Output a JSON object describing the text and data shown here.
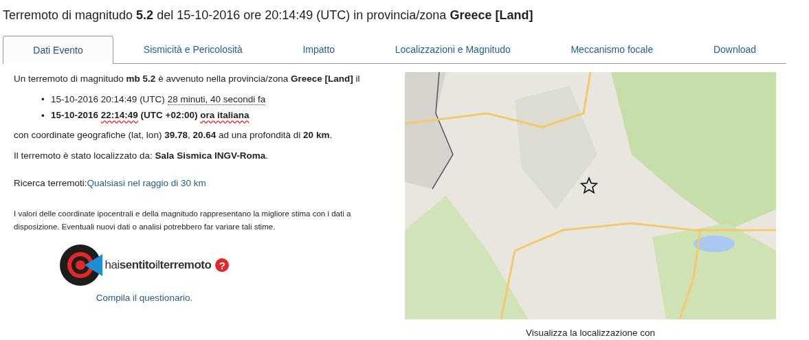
{
  "page_title": "Terremoto di magnitudo **5.2** del 15-10-2016 ore 20:14:49 (UTC) in provincia/zona **Greece [Land]**",
  "tabs": [
    {
      "label": "Dati Evento",
      "selected": true
    },
    {
      "label": "Sismicità e Pericolosità",
      "selected": false
    },
    {
      "label": "Impatto",
      "selected": false
    },
    {
      "label": "Localizzazioni e Magnitudo",
      "selected": false
    },
    {
      "label": "Meccanismo focale",
      "selected": false
    },
    {
      "label": "Download",
      "selected": false
    }
  ],
  "intro": "Un terremoto di magnitudo **mb 5.2** è avvenuto nella provincia/zona **Greece [Land]** il",
  "times": [
    {
      "kind": "utc",
      "bullet": "•",
      "date": "15-10-2016",
      "time": "20:14:49",
      "zone": "(UTC)",
      "note": "28 minuti, 40 secondi fa",
      "annotated": false
    },
    {
      "kind": "local",
      "bullet": "•",
      "date": "15-10-2016",
      "time": "22:14:49",
      "zone": "(UTC +02:00)",
      "note": "ora italiana",
      "annotated": true
    }
  ],
  "coordinates": "con coordinate geografiche (lat, lon) **39.78**, **20.64** ad una profondità di **20 km**.",
  "located_by": "Il terremoto è stato localizzato da: **Sala Sismica INGV-Roma**.",
  "search": {
    "label": "Ricerca terremoti:",
    "link": "Qualsiasi nel raggio di 30 km"
  },
  "disclaimer": "I valori delle coordinate ipocentrali e della magnitudo rappresentano la migliore stima con i dati a disposizione. Eventuali nuovi dati o analisi potrebbero far variare tali stime.",
  "survey": {
    "logo_text": [
      "hai",
      "sentito",
      "il",
      "terremoto"
    ],
    "help": "?",
    "link": "Compila il questionario."
  },
  "map": {
    "kind": "picture",
    "caption": "Visualizza la localizzazione con"
  }
}
